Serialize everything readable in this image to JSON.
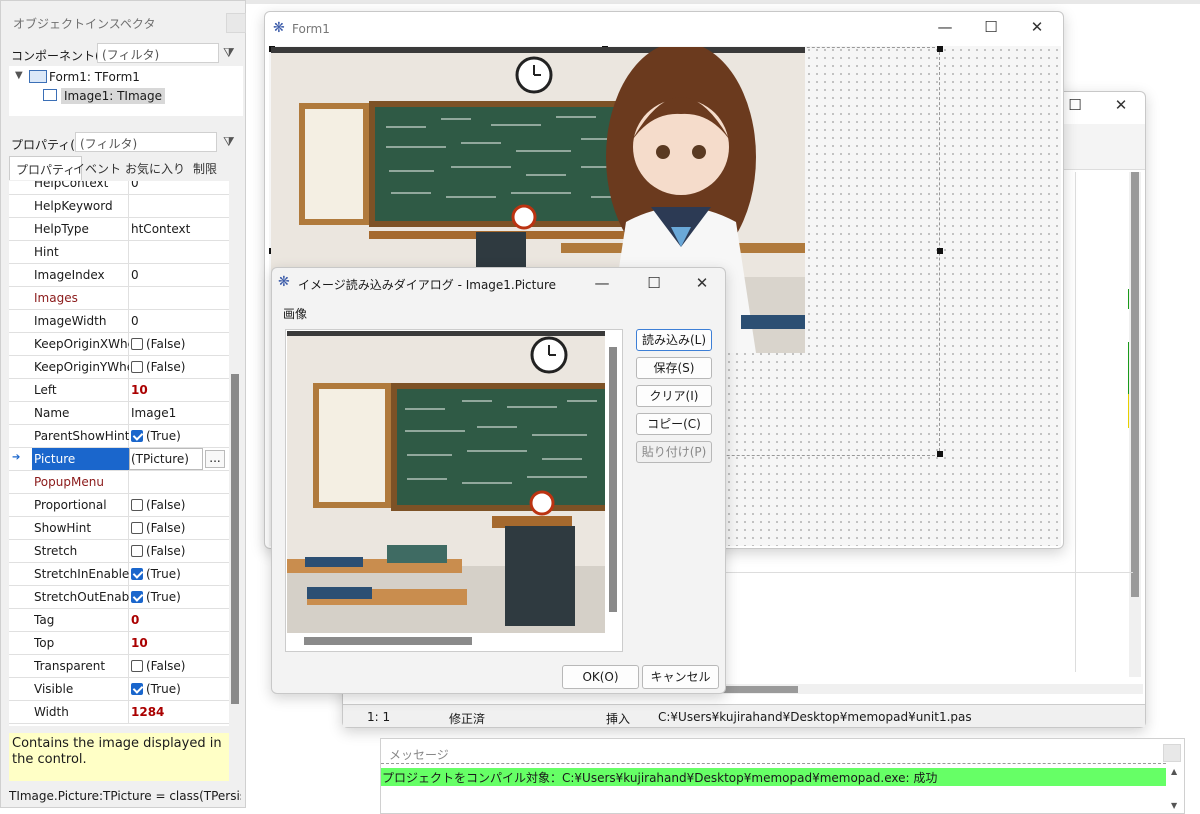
{
  "inspector": {
    "title": "オブジェクトインスペクタ",
    "components_label": "コンポーネント(m)",
    "components_filter": "(フィルタ)",
    "tree": [
      "Form1: TForm1",
      "Image1: TImage"
    ],
    "properties_label": "プロパティ(P)",
    "properties_filter": "(フィルタ)",
    "tabs": [
      "プロパティ",
      "イベント",
      "お気に入り",
      "制限"
    ],
    "rows": [
      {
        "name": "HelpContext",
        "value": "0"
      },
      {
        "name": "HelpKeyword",
        "value": ""
      },
      {
        "name": "HelpType",
        "value": "htContext"
      },
      {
        "name": "Hint",
        "value": ""
      },
      {
        "name": "ImageIndex",
        "value": "0"
      },
      {
        "name": "Images",
        "value": ""
      },
      {
        "name": "ImageWidth",
        "value": "0"
      },
      {
        "name": "KeepOriginXWhe",
        "value": "(False)"
      },
      {
        "name": "KeepOriginYWhe",
        "value": "(False)"
      },
      {
        "name": "Left",
        "value": "10"
      },
      {
        "name": "Name",
        "value": "Image1"
      },
      {
        "name": "ParentShowHint",
        "value": "(True)"
      },
      {
        "name": "Picture",
        "value": "(TPicture)"
      },
      {
        "name": "PopupMenu",
        "value": ""
      },
      {
        "name": "Proportional",
        "value": "(False)"
      },
      {
        "name": "ShowHint",
        "value": "(False)"
      },
      {
        "name": "Stretch",
        "value": "(False)"
      },
      {
        "name": "StretchInEnabled",
        "value": "(True)"
      },
      {
        "name": "StretchOutEnable",
        "value": "(True)"
      },
      {
        "name": "Tag",
        "value": "0"
      },
      {
        "name": "Top",
        "value": "10"
      },
      {
        "name": "Transparent",
        "value": "(False)"
      },
      {
        "name": "Visible",
        "value": "(True)"
      },
      {
        "name": "Width",
        "value": "1284"
      }
    ],
    "ellipsis": "...",
    "help_text": "Contains the image displayed in the control.",
    "status_text": "TImage.Picture:TPicture = class(TPersiste"
  },
  "form1": {
    "title": "Form1"
  },
  "dialog": {
    "title": "イメージ読み込みダイアログ - Image1.Picture",
    "group_label": "画像",
    "buttons": {
      "load": "読み込み(L)",
      "save": "保存(S)",
      "clear": "クリア(I)",
      "copy": "コピー(C)",
      "paste": "貼り付け(P)"
    },
    "ok": "OK(O)",
    "cancel": "キャンセル"
  },
  "editor": {
    "status": {
      "position": "1:  1",
      "modified": "修正済",
      "mode": "挿入",
      "path": "C:¥Users¥kujirahand¥Desktop¥memopad¥unit1.pas"
    }
  },
  "messages": {
    "title": "メッセージ",
    "line": "プロジェクトをコンパイル対象：C:¥Users¥kujirahand¥Desktop¥memopad¥memopad.exe: 成功"
  },
  "colors": {
    "accent": "#1a66cc",
    "success": "#66ff66",
    "help_bg": "#ffffc6"
  }
}
